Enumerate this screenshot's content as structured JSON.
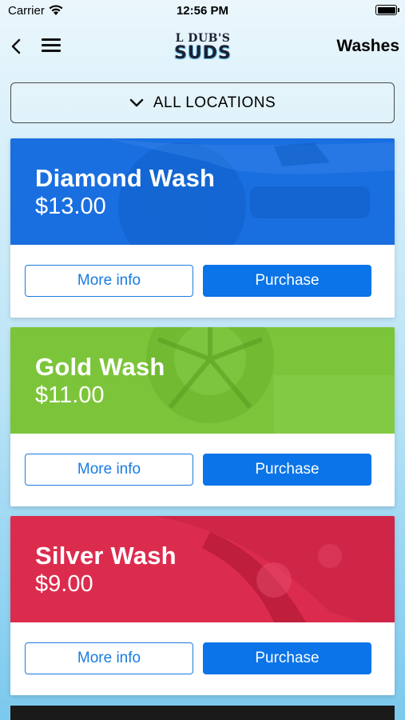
{
  "status_bar": {
    "carrier": "Carrier",
    "time": "12:56 PM"
  },
  "nav": {
    "logo_top": "L DUB'S",
    "logo_bottom": "SUDS",
    "title": "Washes"
  },
  "location_select": {
    "label": "ALL LOCATIONS"
  },
  "cards": [
    {
      "title": "Diamond Wash",
      "price": "$13.00",
      "more_info_label": "More info",
      "purchase_label": "Purchase",
      "color": "#1a6fe0"
    },
    {
      "title": "Gold Wash",
      "price": "$11.00",
      "more_info_label": "More info",
      "purchase_label": "Purchase",
      "color": "#7cc53a"
    },
    {
      "title": "Silver Wash",
      "price": "$9.00",
      "more_info_label": "More info",
      "purchase_label": "Purchase",
      "color": "#dc2c4e"
    }
  ],
  "colors": {
    "accent": "#0a74e8",
    "diamond": "#1a6fe0",
    "gold": "#7cc53a",
    "silver": "#dc2c4e"
  }
}
